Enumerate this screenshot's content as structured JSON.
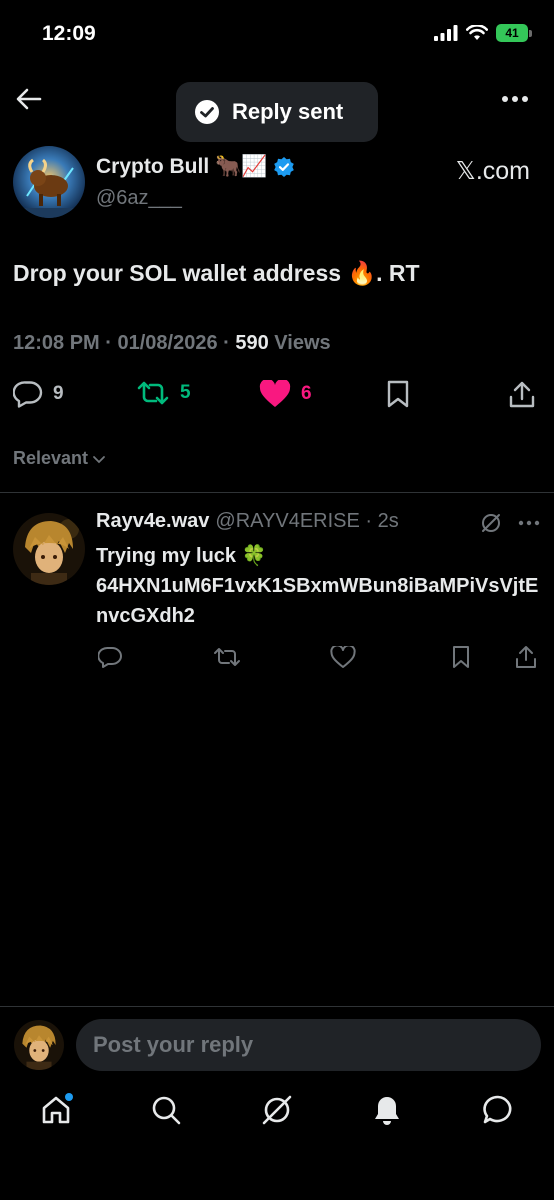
{
  "status_bar": {
    "time": "12:09",
    "battery": "41"
  },
  "header": {
    "back_icon": "arrow-left-icon",
    "more_icon": "more-horizontal-icon"
  },
  "toast": {
    "icon": "check-circle-icon",
    "text": "Reply sent"
  },
  "tweet": {
    "author_name": "Crypto Bull 🐂📈",
    "verified_icon": "verified-badge-icon",
    "handle": "@6az___",
    "source": "𝕏.com",
    "text": "Drop your SOL wallet address 🔥. RT",
    "timestamp": "12:08 PM · 01/08/2026 · ",
    "views_count": "590",
    "views_label": " Views",
    "actions": {
      "replies": "9",
      "reposts": "5",
      "likes": "6"
    }
  },
  "sort": {
    "label": "Relevant"
  },
  "reply": {
    "name": "Rayv4e.wav",
    "handle": "@RAYV4ERISE · 2s",
    "text_line1": "Trying my luck 🍀",
    "text_line2": "64HXN1uM6F1vxK1SBxmWBun8iBaMPiVsVjtEnvcGXdh2"
  },
  "composer": {
    "placeholder": "Post your reply"
  },
  "colors": {
    "background": "#000000",
    "accent_blue": "#1d9bf0",
    "repost_green": "#00ba7c",
    "like_pink": "#f91880",
    "muted": "#71767b",
    "battery_green": "#34c759"
  },
  "nav": [
    "home-icon",
    "search-icon",
    "grok-icon",
    "notifications-icon",
    "messages-icon"
  ]
}
